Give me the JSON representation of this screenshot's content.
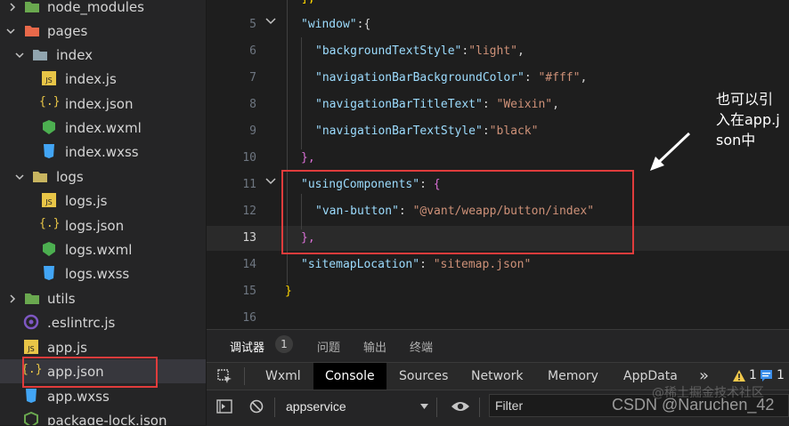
{
  "sidebar": {
    "items": [
      {
        "label": "node_modules"
      },
      {
        "label": "pages"
      },
      {
        "label": "index"
      },
      {
        "label": "index.js"
      },
      {
        "label": "index.json"
      },
      {
        "label": "index.wxml"
      },
      {
        "label": "index.wxss"
      },
      {
        "label": "logs"
      },
      {
        "label": "logs.js"
      },
      {
        "label": "logs.json"
      },
      {
        "label": "logs.wxml"
      },
      {
        "label": "logs.wxss"
      },
      {
        "label": "utils"
      },
      {
        "label": ".eslintrc.js"
      },
      {
        "label": "app.js"
      },
      {
        "label": "app.json"
      },
      {
        "label": "app.wxss"
      },
      {
        "label": "package-lock.json"
      }
    ]
  },
  "editor": {
    "line_numbers": [
      "5",
      "6",
      "7",
      "8",
      "9",
      "10",
      "11",
      "12",
      "13",
      "14",
      "15",
      "16"
    ],
    "lines": {
      "l4": "],",
      "l5_key": "\"window\"",
      "l5_rest": ":{",
      "l6_key": "\"backgroundTextStyle\"",
      "l6_val": "\"light\"",
      "l7_key": "\"navigationBarBackgroundColor\"",
      "l7_val": "\"#fff\"",
      "l8_key": "\"navigationBarTitleText\"",
      "l8_val": "\"Weixin\"",
      "l9_key": "\"navigationBarTextStyle\"",
      "l9_val": "\"black\"",
      "l10": "},",
      "l11_key": "\"usingComponents\"",
      "l11_rest": "{",
      "l12_key": "\"van-button\"",
      "l12_val": "\"@vant/weapp/button/index\"",
      "l13": "},",
      "l14_key": "\"sitemapLocation\"",
      "l14_val": "\"sitemap.json\"",
      "l15": "}"
    },
    "annotation": "也可以引入在app.json中"
  },
  "panel": {
    "tabs": [
      "调试器",
      "问题",
      "输出",
      "终端"
    ],
    "badge": "1",
    "devtools_tabs": [
      "Wxml",
      "Console",
      "Sources",
      "Network",
      "Memory",
      "AppData"
    ],
    "more": "»",
    "warnings": "1",
    "messages": "1",
    "context": "appservice",
    "filter_placeholder": "Filter",
    "watermark": "CSDN @Naruchen_42",
    "watermark2": "@稀土掘金技术社区"
  },
  "colors": {
    "key": "#9cdcfe",
    "string": "#ce9178",
    "highlight_box": "#e03c3c"
  }
}
